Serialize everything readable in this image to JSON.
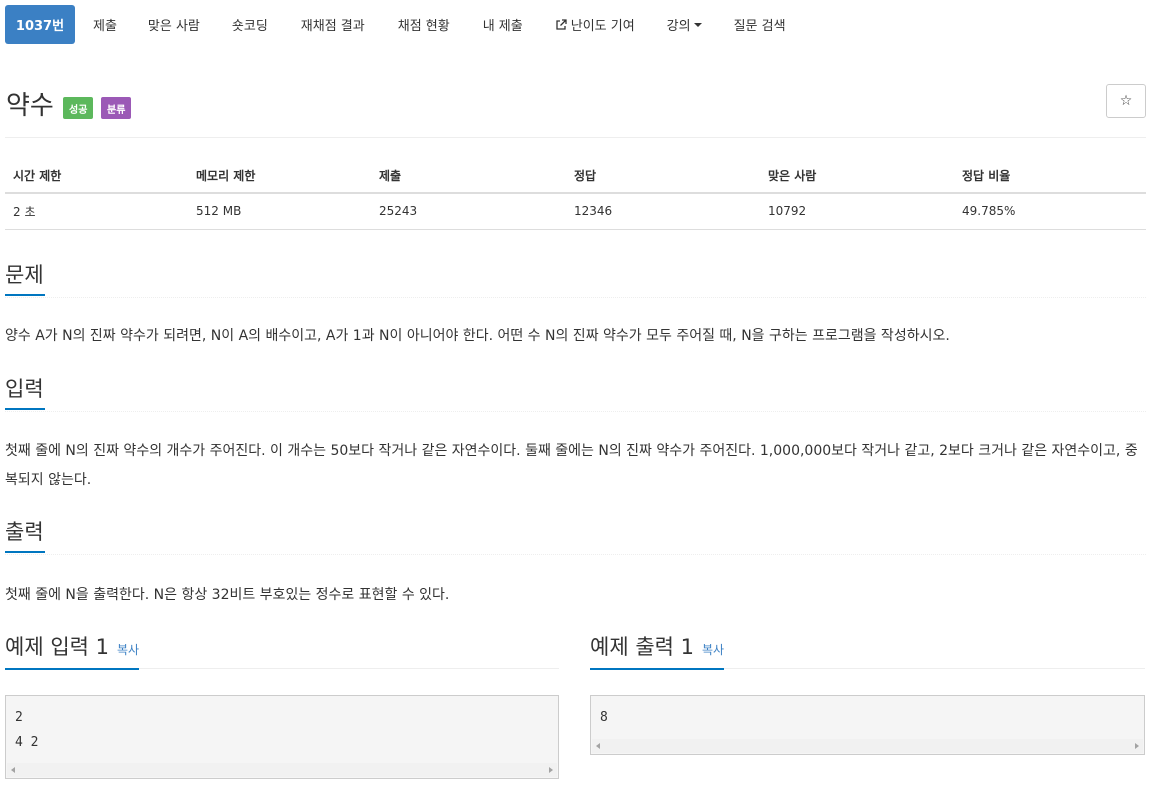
{
  "nav": {
    "tabs": [
      {
        "label": "1037번"
      },
      {
        "label": "제출"
      },
      {
        "label": "맞은 사람"
      },
      {
        "label": "숏코딩"
      },
      {
        "label": "재채점 결과"
      },
      {
        "label": "채점 현황"
      },
      {
        "label": "내 제출"
      },
      {
        "label": "난이도 기여",
        "icon": "external-link-icon"
      },
      {
        "label": "강의",
        "icon": "caret-down-icon"
      },
      {
        "label": "질문 검색"
      }
    ]
  },
  "problem": {
    "title": "약수",
    "badges": {
      "success": "성공",
      "category": "분류"
    },
    "star_icon": "☆"
  },
  "info": {
    "headers": [
      "시간 제한",
      "메모리 제한",
      "제출",
      "정답",
      "맞은 사람",
      "정답 비율"
    ],
    "values": [
      "2 초",
      "512 MB",
      "25243",
      "12346",
      "10792",
      "49.785%"
    ]
  },
  "sections": {
    "description": {
      "heading": "문제",
      "text": "양수 A가 N의 진짜 약수가 되려면, N이 A의 배수이고, A가 1과 N이 아니어야 한다. 어떤 수 N의 진짜 약수가 모두 주어질 때, N을 구하는 프로그램을 작성하시오."
    },
    "input": {
      "heading": "입력",
      "text": "첫째 줄에 N의 진짜 약수의 개수가 주어진다. 이 개수는 50보다 작거나 같은 자연수이다. 둘째 줄에는 N의 진짜 약수가 주어진다. 1,000,000보다 작거나 같고, 2보다 크거나 같은 자연수이고, 중복되지 않는다."
    },
    "output": {
      "heading": "출력",
      "text": "첫째 줄에 N을 출력한다. N은 항상 32비트 부호있는 정수로 표현할 수 있다."
    }
  },
  "examples": {
    "input": {
      "heading": "예제 입력 1",
      "copy": "복사",
      "content": "2\n4 2"
    },
    "output": {
      "heading": "예제 출력 1",
      "copy": "복사",
      "content": "8"
    }
  },
  "colors": {
    "primary": "#3b80c4",
    "success": "#5cb85c",
    "category": "#9b59b6",
    "underline": "#0076c0"
  }
}
